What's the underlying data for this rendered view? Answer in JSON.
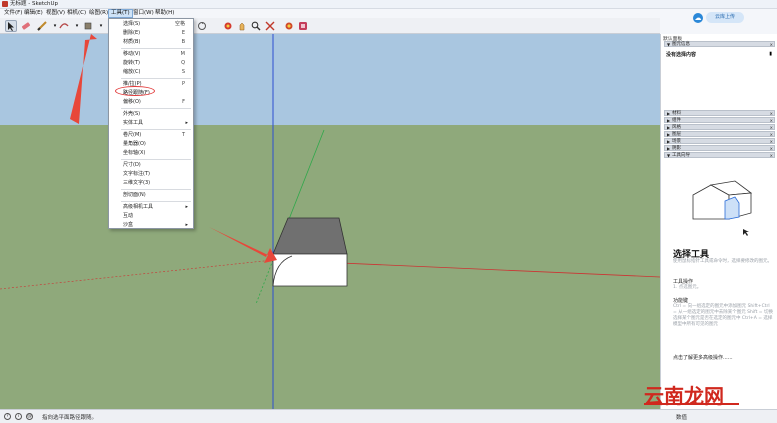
{
  "window": {
    "title": "无标题 - SketchUp"
  },
  "menubar": {
    "items": [
      {
        "label": "文件(F)"
      },
      {
        "label": "编辑(E)"
      },
      {
        "label": "视图(V)"
      },
      {
        "label": "相机(C)"
      },
      {
        "label": "绘图(R)"
      },
      {
        "label": "工具(T)"
      },
      {
        "label": "窗口(W)"
      },
      {
        "label": "帮助(H)"
      }
    ],
    "active_index": 5
  },
  "toolbar": {
    "icons": [
      "select-icon",
      "eraser-icon",
      "pencil-icon",
      "shape-icon",
      "rectangle-icon",
      "orbit-icon",
      "pan-icon",
      "zoom-icon",
      "zoom-extents-icon",
      "gem-icon",
      "warehouse-icon"
    ]
  },
  "upload": {
    "label": "云库上传"
  },
  "tools_menu": {
    "items": [
      {
        "label": "选择(S)",
        "key": "空格",
        "type": "item"
      },
      {
        "label": "删除(E)",
        "key": "E",
        "type": "item"
      },
      {
        "label": "材质(B)",
        "key": "B",
        "type": "item"
      },
      {
        "type": "sep"
      },
      {
        "label": "移动(V)",
        "key": "M",
        "type": "item"
      },
      {
        "label": "旋转(T)",
        "key": "Q",
        "type": "item"
      },
      {
        "label": "缩放(C)",
        "key": "S",
        "type": "item"
      },
      {
        "type": "sep"
      },
      {
        "label": "推/拉(P)",
        "key": "P",
        "type": "item"
      },
      {
        "label": "路径跟随(F)",
        "key": "",
        "type": "item",
        "highlight": true
      },
      {
        "label": "偏移(O)",
        "key": "F",
        "type": "item"
      },
      {
        "type": "sep"
      },
      {
        "label": "外壳(S)",
        "key": "",
        "type": "item"
      },
      {
        "label": "实体工具",
        "key": "",
        "type": "submenu"
      },
      {
        "type": "sep"
      },
      {
        "label": "卷尺(M)",
        "key": "T",
        "type": "item"
      },
      {
        "label": "量角器(O)",
        "key": "",
        "type": "item"
      },
      {
        "label": "坐标轴(X)",
        "key": "",
        "type": "item"
      },
      {
        "type": "sep"
      },
      {
        "label": "尺寸(D)",
        "key": "",
        "type": "item"
      },
      {
        "label": "文字标注(T)",
        "key": "",
        "type": "item"
      },
      {
        "label": "三维文字(3)",
        "key": "",
        "type": "item"
      },
      {
        "type": "sep"
      },
      {
        "label": "剖切面(N)",
        "key": "",
        "type": "item"
      },
      {
        "type": "sep"
      },
      {
        "label": "高级相机工具",
        "key": "",
        "type": "submenu"
      },
      {
        "label": "互动",
        "key": "",
        "type": "item"
      },
      {
        "label": "沙盒",
        "key": "",
        "type": "submenu"
      }
    ]
  },
  "panel": {
    "title": "默认面板",
    "entity_info_header": "图元信息",
    "no_selection": "没有选择内容",
    "collapsed_sections": [
      "材料",
      "组件",
      "风格",
      "图层",
      "场景",
      "阴影"
    ],
    "instructor_header": "工具向导",
    "tool_title": "选择工具",
    "tool_desc": "使用鼠标指针工具或命令时，选择要修改的图元。",
    "ops_title": "工具操作",
    "ops_text": "1. 点选图元。",
    "keys_title": "功能键",
    "keys_text": "Ctrl = 向一组选定的图元中添加图元 Shift+Ctrl = 从一组选定的图元中去除某个图元 Shift = 切换选择某个图元是否在选定的图元中 Ctrl+A = 选择模型中所有可见的图元",
    "learn_more": "点击了解更多高级操作......"
  },
  "status": {
    "text": "指向选平面路径跟随。",
    "measure_label": "数值"
  },
  "watermark": "云南龙网",
  "colors": {
    "sky": "#a9c6e0",
    "ground": "#8fa97b",
    "highlight_ring": "#e23b3b",
    "arrow": "#e8473a",
    "accent": "#2b88d8"
  }
}
